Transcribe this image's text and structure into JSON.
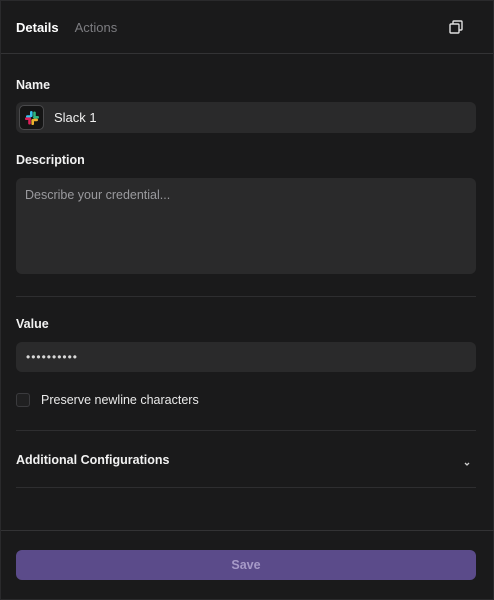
{
  "header": {
    "tabs": [
      {
        "label": "Details",
        "active": true
      },
      {
        "label": "Actions",
        "active": false
      }
    ],
    "copy_icon": "copy-icon"
  },
  "name": {
    "label": "Name",
    "value": "Slack 1",
    "icon": "slack-logo-icon"
  },
  "description": {
    "label": "Description",
    "placeholder": "Describe your credential..."
  },
  "value": {
    "label": "Value",
    "masked": "••••••••••"
  },
  "preserve_newlines": {
    "label": "Preserve newline characters",
    "checked": false
  },
  "additional_configurations": {
    "label": "Additional Configurations",
    "expanded": false
  },
  "footer": {
    "save_label": "Save"
  },
  "colors": {
    "background": "#1a1a1b",
    "field": "#2a2a2b",
    "save_button": "#5b4b8a"
  }
}
